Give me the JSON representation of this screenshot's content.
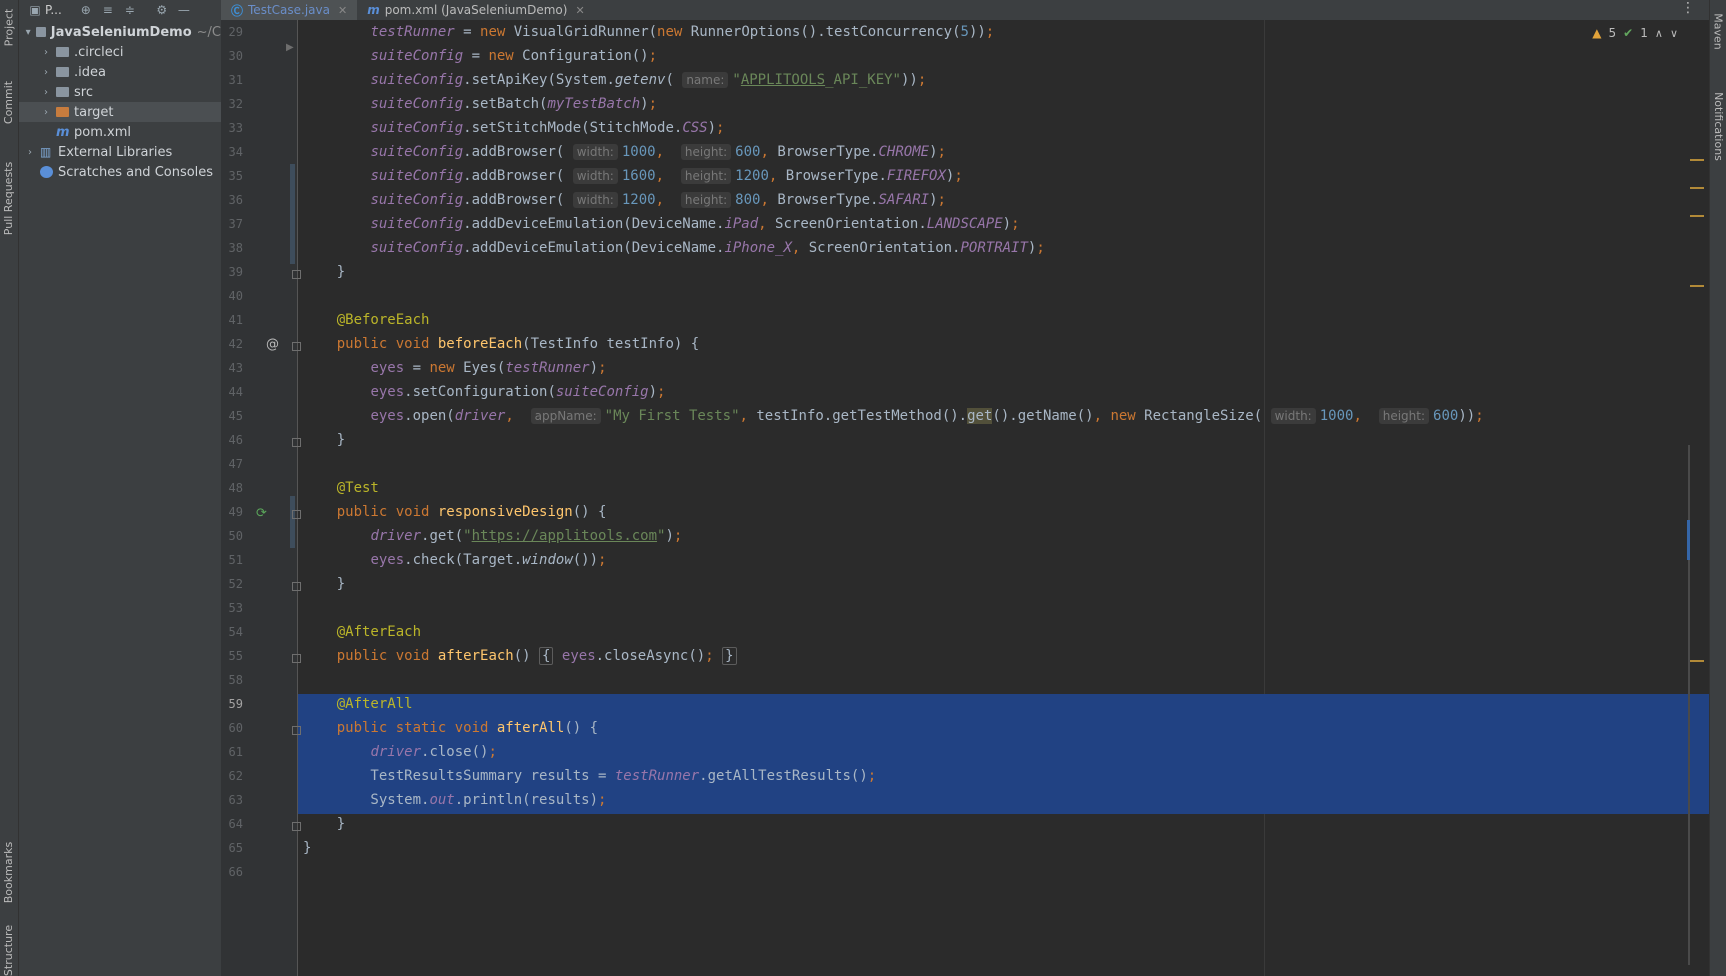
{
  "left_tool_tabs": [
    "Project",
    "Commit",
    "Pull Requests",
    "Bookmarks",
    "Structure"
  ],
  "project_panel": {
    "title": "P...",
    "tree": [
      {
        "label": "JavaSeleniumDemo",
        "suffix": "~/C",
        "depth": 0,
        "expanded": true,
        "icon": "module-folder-icon",
        "bold": true
      },
      {
        "label": ".circleci",
        "depth": 1,
        "expanded": false,
        "icon": "folder-icon"
      },
      {
        "label": ".idea",
        "depth": 1,
        "expanded": false,
        "icon": "folder-icon"
      },
      {
        "label": "src",
        "depth": 1,
        "expanded": false,
        "icon": "folder-icon"
      },
      {
        "label": "target",
        "depth": 1,
        "expanded": false,
        "icon": "excluded-folder-icon",
        "selected": true
      },
      {
        "label": "pom.xml",
        "depth": 1,
        "icon": "maven-file-icon"
      },
      {
        "label": "External Libraries",
        "depth": 0,
        "expanded": false,
        "icon": "library-icon"
      },
      {
        "label": "Scratches and Consoles",
        "depth": 0,
        "icon": "scratches-icon"
      }
    ]
  },
  "tabs": [
    {
      "label": "TestCase.java",
      "active": true,
      "icon_letter": "C"
    },
    {
      "label": "pom.xml (JavaSeleniumDemo)",
      "active": false,
      "icon_letter": "m"
    }
  ],
  "inspections": {
    "warnings": "5",
    "passed": "1"
  },
  "right_tool_tabs": [
    "Maven",
    "Notifications"
  ],
  "code": [
    {
      "n": "29",
      "html": "        <span class=\"fld\">testRunner</span> = <span class=\"kw\">new</span> VisualGridRunner(<span class=\"kw\">new</span> RunnerOptions().testConcurrency(<span class=\"num\">5</span>))<span class=\"kw\">;</span>"
    },
    {
      "n": "30",
      "html": "        <span class=\"fld\">suiteConfig</span> = <span class=\"kw\">new</span> Configuration()<span class=\"kw\">;</span>"
    },
    {
      "n": "31",
      "html": "        <span class=\"fld\">suiteConfig</span>.setApiKey(System.<span class=\"ital\">getenv</span>( <span class=\"hint\">name:</span><span class=\"str\">\"<u>APPLITOOLS</u>_API_KEY\"</span>))<span class=\"kw\">;</span>"
    },
    {
      "n": "32",
      "html": "        <span class=\"fld\">suiteConfig</span>.setBatch(<span class=\"fld\">myTestBatch</span>)<span class=\"kw\">;</span>"
    },
    {
      "n": "33",
      "html": "        <span class=\"fld\">suiteConfig</span>.setStitchMode(StitchMode.<span class=\"fld\">CSS</span>)<span class=\"kw\">;</span>"
    },
    {
      "n": "34",
      "html": "        <span class=\"fld\">suiteConfig</span>.addBrowser( <span class=\"hint\">width:</span><span class=\"num\">1000</span><span class=\"kw\">,</span>  <span class=\"hint\">height:</span><span class=\"num\">600</span><span class=\"kw\">,</span> BrowserType.<span class=\"fld\">CHROME</span>)<span class=\"kw\">;</span>"
    },
    {
      "n": "35",
      "html": "        <span class=\"fld\">suiteConfig</span>.addBrowser( <span class=\"hint\">width:</span><span class=\"num\">1600</span><span class=\"kw\">,</span>  <span class=\"hint\">height:</span><span class=\"num\">1200</span><span class=\"kw\">,</span> BrowserType.<span class=\"fld\">FIREFOX</span>)<span class=\"kw\">;</span>"
    },
    {
      "n": "36",
      "html": "        <span class=\"fld\">suiteConfig</span>.addBrowser( <span class=\"hint\">width:</span><span class=\"num\">1200</span><span class=\"kw\">,</span>  <span class=\"hint\">height:</span><span class=\"num\">800</span><span class=\"kw\">,</span> BrowserType.<span class=\"fld\">SAFARI</span>)<span class=\"kw\">;</span>"
    },
    {
      "n": "37",
      "html": "        <span class=\"fld\">suiteConfig</span>.addDeviceEmulation(DeviceName.<span class=\"fld\">iPad</span><span class=\"kw\">,</span> ScreenOrientation.<span class=\"fld\">LANDSCAPE</span>)<span class=\"kw\">;</span>"
    },
    {
      "n": "38",
      "html": "        <span class=\"fld\">suiteConfig</span>.addDeviceEmulation(DeviceName.<span class=\"fld\">iPhone_X</span><span class=\"kw\">,</span> ScreenOrientation.<span class=\"fld\">PORTRAIT</span>)<span class=\"kw\">;</span>"
    },
    {
      "n": "39",
      "html": "    }"
    },
    {
      "n": "40",
      "html": ""
    },
    {
      "n": "41",
      "html": "    <span class=\"ann\">@BeforeEach</span>"
    },
    {
      "n": "42",
      "html": "    <span class=\"kw\">public void</span> <span class=\"fn\">beforeEach</span>(TestInfo testInfo) {"
    },
    {
      "n": "43",
      "html": "        <span class=\"fld-n\">eyes</span> = <span class=\"kw\">new</span> Eyes(<span class=\"fld\">testRunner</span>)<span class=\"kw\">;</span>"
    },
    {
      "n": "44",
      "html": "        <span class=\"fld-n\">eyes</span>.setConfiguration(<span class=\"fld\">suiteConfig</span>)<span class=\"kw\">;</span>"
    },
    {
      "n": "45",
      "html": "        <span class=\"fld-n\">eyes</span>.open(<span class=\"fld\">driver</span><span class=\"kw\">,</span>  <span class=\"hint\">appName:</span><span class=\"str\">\"My First Tests\"</span><span class=\"kw\">,</span> testInfo.getTestMethod().<span class=\"hl-usage\">get</span>().getName()<span class=\"kw\">,</span> <span class=\"kw\">new</span> RectangleSize( <span class=\"hint\">width:</span><span class=\"num\">1000</span><span class=\"kw\">,</span>  <span class=\"hint\">height:</span><span class=\"num\">600</span>))<span class=\"kw\">;</span>"
    },
    {
      "n": "46",
      "html": "    }"
    },
    {
      "n": "47",
      "html": ""
    },
    {
      "n": "48",
      "html": "    <span class=\"ann\">@Test</span>"
    },
    {
      "n": "49",
      "html": "    <span class=\"kw\">public void</span> <span class=\"fn\">responsiveDesign</span>() {"
    },
    {
      "n": "50",
      "html": "        <span class=\"fld\">driver</span>.get(<span class=\"str\">\"</span><span class=\"link\">https://applitools.com</span><span class=\"str\">\"</span>)<span class=\"kw\">;</span>"
    },
    {
      "n": "51",
      "html": "        <span class=\"fld-n\">eyes</span>.check(Target.<span class=\"ital\">window</span>())<span class=\"kw\">;</span>"
    },
    {
      "n": "52",
      "html": "    }"
    },
    {
      "n": "53",
      "html": ""
    },
    {
      "n": "54",
      "html": "    <span class=\"ann\">@AfterEach</span>"
    },
    {
      "n": "55",
      "html": "    <span class=\"kw\">public void</span> <span class=\"fn\">afterEach</span>() <span class=\"fold-box\">{</span> <span class=\"fld-n\">eyes</span>.closeAsync()<span class=\"kw\">;</span> <span class=\"fold-box\">}</span>"
    },
    {
      "n": "58",
      "html": ""
    },
    {
      "n": "59",
      "html": "    <span class=\"ann\">@AfterAll</span>"
    },
    {
      "n": "60",
      "html": "    <span class=\"kw\">public static void</span> <span class=\"fn\">afterAll</span>() {"
    },
    {
      "n": "61",
      "html": "        <span class=\"fld\">driver</span>.close()<span class=\"kw\">;</span>"
    },
    {
      "n": "62",
      "html": "        TestResultsSummary results = <span class=\"fld\">testRunner</span>.getAllTestResults()<span class=\"kw\">;</span>"
    },
    {
      "n": "63",
      "html": "        System.<span class=\"fld\">out</span>.println(results)<span class=\"kw\">;</span>"
    },
    {
      "n": "64",
      "html": "    }"
    },
    {
      "n": "65",
      "html": "}"
    },
    {
      "n": "66",
      "html": ""
    }
  ],
  "colors": {
    "selection": "#214283",
    "keyword": "#cc7832",
    "field": "#9876aa",
    "string": "#6a8759",
    "number": "#6897bb",
    "annotation": "#bbb529",
    "method_decl": "#ffc66d",
    "warning": "#e2a33a",
    "ok": "#62a65e"
  }
}
